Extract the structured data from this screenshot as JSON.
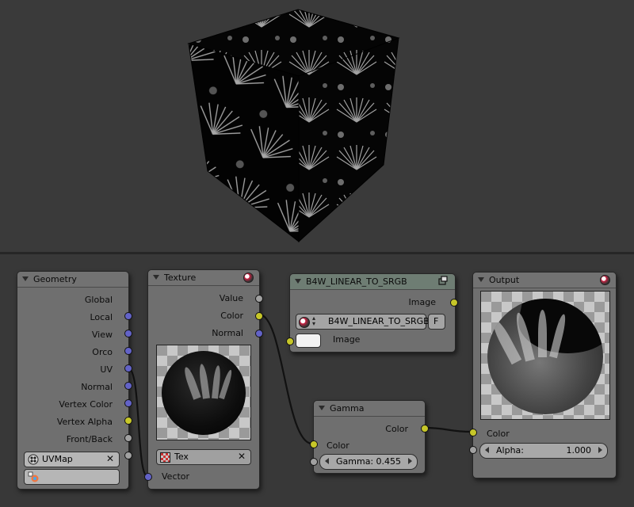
{
  "colors": {
    "vector_socket": "#6363c7",
    "color_socket": "#c7c729",
    "value_socket": "#a1a1a1",
    "node_body": "#6f6f6f",
    "group_header": "#6e7d73"
  },
  "viewport": {
    "object": "textured-cube",
    "texture": "palm-leaf-pattern"
  },
  "nodes": {
    "geometry": {
      "title": "Geometry",
      "outputs": [
        "Global",
        "Local",
        "View",
        "Orco",
        "UV",
        "Normal",
        "Vertex Color",
        "Vertex Alpha",
        "Front/Back"
      ],
      "uv_map": "UVMap",
      "vertex_color_field": ""
    },
    "texture": {
      "title": "Texture",
      "outputs": [
        "Value",
        "Color",
        "Normal"
      ],
      "texture_name": "Tex",
      "input_vector": "Vector"
    },
    "group": {
      "title": "B4W_LINEAR_TO_SRGB",
      "output": "Image",
      "datablock": "B4W_LINEAR_TO_SRGB",
      "fake_user": "F",
      "input": "Image"
    },
    "gamma": {
      "title": "Gamma",
      "output": "Color",
      "input_color": "Color",
      "gamma_label": "Gamma:",
      "gamma_value": "0.455"
    },
    "output": {
      "title": "Output",
      "input_color": "Color",
      "alpha_label": "Alpha:",
      "alpha_value": "1.000"
    }
  }
}
